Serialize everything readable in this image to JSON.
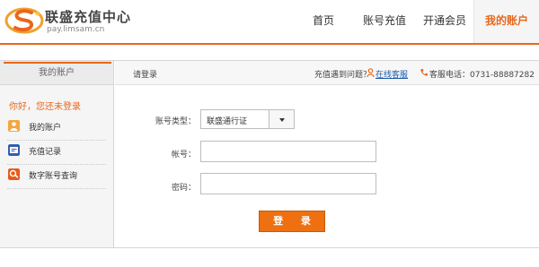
{
  "brand": {
    "title": "联盛充值中心",
    "url": "pay.limsam.cn",
    "logo_icon": "limsam-s-logo"
  },
  "nav": {
    "items": [
      {
        "label": "首页",
        "active": false
      },
      {
        "label": "账号充值",
        "active": false
      },
      {
        "label": "开通会员",
        "active": false
      },
      {
        "label": "我的账户",
        "active": true
      }
    ]
  },
  "sidebar": {
    "header": "我的账户",
    "greeting": "你好，您还未登录",
    "items": [
      {
        "label": "我的账户",
        "icon": "user-icon"
      },
      {
        "label": "充值记录",
        "icon": "record-icon"
      },
      {
        "label": "数字账号查询",
        "icon": "query-icon"
      }
    ]
  },
  "topbar": {
    "left": "请登录",
    "help_question": "充值遇到问题？",
    "online_service": "在线客服",
    "service_phone": "客服电话：0731-88887282"
  },
  "form": {
    "account_type_label": "账号类型：",
    "account_type_value": "联盛通行证",
    "account_label": "帐号：",
    "account_value": "",
    "password_label": "密码：",
    "password_value": "",
    "login_label": "登 录"
  },
  "colors": {
    "accent": "#e8671b",
    "button": "#ee7011",
    "link": "#1a5aa8",
    "sidebar_bg": "#f5f5f5"
  }
}
